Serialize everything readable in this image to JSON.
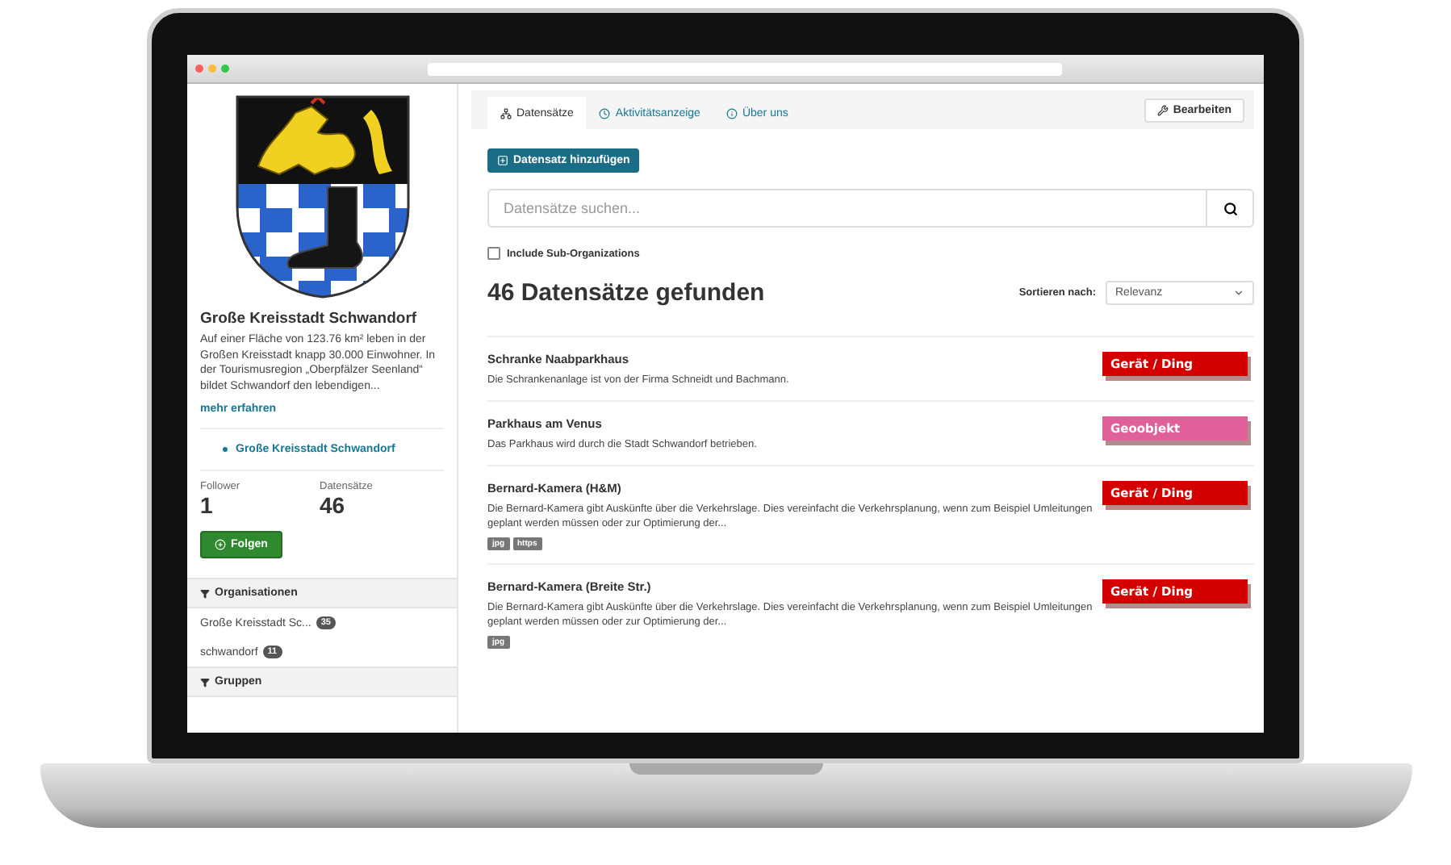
{
  "sidebar": {
    "title": "Große Kreisstadt Schwandorf",
    "description": "Auf einer Fläche von 123.76 km² leben in der Großen Kreisstadt knapp 30.000 Einwohner. In der Tourismusregion „Oberpfälzer Seenland“ bildet Schwandorf den lebendigen...",
    "more_link": "mehr erfahren",
    "breadcrumb": [
      "Große Kreisstadt Schwandorf"
    ],
    "stats": [
      {
        "label": "Follower",
        "value": "1"
      },
      {
        "label": "Datensätze",
        "value": "46"
      }
    ],
    "follow_button": "Folgen",
    "facets": [
      {
        "title": "Organisationen",
        "items": [
          {
            "label": "Große Kreisstadt Sc...",
            "count": "35"
          },
          {
            "label": "schwandorf",
            "count": "11"
          }
        ]
      },
      {
        "title": "Gruppen"
      }
    ]
  },
  "main": {
    "tabs": [
      {
        "label": "Datensätze",
        "selected": true
      },
      {
        "label": "Aktivitätsanzeige",
        "selected": false
      },
      {
        "label": "Über uns",
        "selected": false
      }
    ],
    "edit_button": "Bearbeiten",
    "add_button": "Datensatz hinzufügen",
    "search": {
      "placeholder": "Datensätze suchen..."
    },
    "include_sub": {
      "label": "Include Sub-Organizations",
      "checked": false
    },
    "results_heading": "46 Datensätze gefunden",
    "sort": {
      "label": "Sortieren nach:",
      "value": "Relevanz"
    },
    "datasets": [
      {
        "title": "Schranke Naabparkhaus",
        "description": "Die Schrankenanlage ist von der Firma Schneidt und Bachmann.",
        "type": {
          "label": "Gerät / Ding",
          "color": "#d40000"
        }
      },
      {
        "title": "Parkhaus am Venus",
        "description": "Das Parkhaus wird durch die Stadt Schwandorf betrieben.",
        "type": {
          "label": "Geoobjekt",
          "color": "#e0609a"
        }
      },
      {
        "title": "Bernard-Kamera (H&M)",
        "description": "Die Bernard-Kamera gibt Auskünfte über die Verkehrslage. Dies vereinfacht die Verkehrsplanung, wenn zum Beispiel Umleitungen geplant werden müssen oder zur Optimierung der...",
        "formats": [
          "jpg",
          "https"
        ],
        "type": {
          "label": "Gerät / Ding",
          "color": "#d40000"
        }
      },
      {
        "title": "Bernard-Kamera (Breite Str.)",
        "description": "Die Bernard-Kamera gibt Auskünfte über die Verkehrslage. Dies vereinfacht die Verkehrsplanung, wenn zum Beispiel Umleitungen geplant werden müssen oder zur Optimierung der...",
        "formats": [
          "jpg"
        ],
        "type": {
          "label": "Gerät / Ding",
          "color": "#d40000"
        }
      }
    ]
  }
}
